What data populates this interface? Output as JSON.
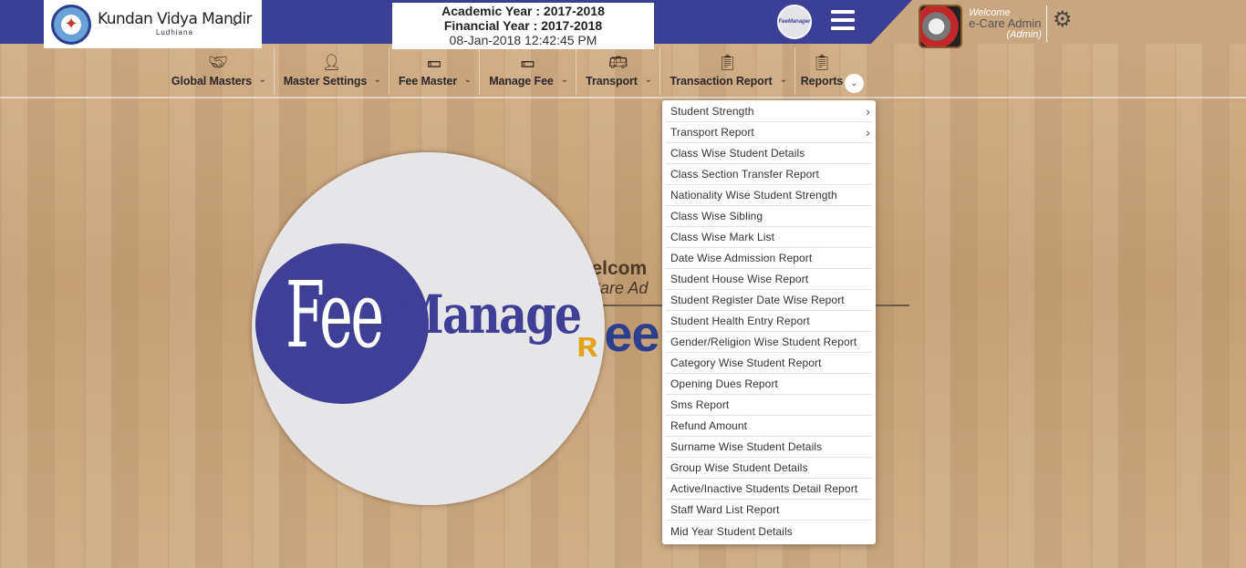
{
  "header": {
    "school_name": "Kundan Vidya Mandir",
    "school_city": "Ludhiana",
    "academic_year": "Academic Year : 2017-2018",
    "financial_year": "Financial Year : 2017-2018",
    "datetime": "08-Jan-2018 12:42:45 PM",
    "brand_mini": "FeeManager",
    "welcome": "Welcome",
    "user_name": "e-Care Admin",
    "user_role": "(Admin)"
  },
  "nav": {
    "items": [
      {
        "label": "Global Masters",
        "icon": "handshake-icon"
      },
      {
        "label": "Master Settings",
        "icon": "user-edit-icon"
      },
      {
        "label": "Fee Master",
        "icon": "money-icon"
      },
      {
        "label": "Manage Fee",
        "icon": "money-icon"
      },
      {
        "label": "Transport",
        "icon": "bus-icon"
      },
      {
        "label": "Transaction Report",
        "icon": "report-icon"
      },
      {
        "label": "Reports",
        "icon": "report-icon"
      }
    ]
  },
  "logo": {
    "fee": "Fee",
    "manager": "Manage"
  },
  "background_text": {
    "welcome": "Welcom",
    "subtitle": "e-Care Ad",
    "brand": "Fee        er"
  },
  "reports_menu": {
    "items": [
      {
        "label": "Student Strength",
        "submenu": true
      },
      {
        "label": "Transport Report",
        "submenu": true
      },
      {
        "label": "Class Wise Student Details",
        "submenu": false
      },
      {
        "label": "Class Section Transfer Report",
        "submenu": false
      },
      {
        "label": "Nationality Wise Student Strength",
        "submenu": false
      },
      {
        "label": "Class Wise Sibling",
        "submenu": false
      },
      {
        "label": "Class Wise Mark List",
        "submenu": false
      },
      {
        "label": "Date Wise Admission Report",
        "submenu": false
      },
      {
        "label": "Student House Wise Report",
        "submenu": false
      },
      {
        "label": "Student Register Date Wise Report",
        "submenu": false
      },
      {
        "label": "Student Health Entry Report",
        "submenu": false
      },
      {
        "label": "Gender/Religion Wise Student Report",
        "submenu": false
      },
      {
        "label": "Category Wise Student Report",
        "submenu": false
      },
      {
        "label": "Opening Dues Report",
        "submenu": false
      },
      {
        "label": "Sms Report",
        "submenu": false
      },
      {
        "label": "Refund Amount",
        "submenu": false
      },
      {
        "label": "Surname Wise Student Details",
        "submenu": false
      },
      {
        "label": "Group Wise Student Details",
        "submenu": false
      },
      {
        "label": "Active/Inactive Students Detail Report",
        "submenu": false
      },
      {
        "label": "Staff Ward List Report",
        "submenu": false
      },
      {
        "label": "Mid Year Student Details",
        "submenu": false
      }
    ]
  },
  "colors": {
    "header_blue": "#3b3f95",
    "wood": "#caa57a",
    "logo_yellow": "#e2a21a"
  }
}
